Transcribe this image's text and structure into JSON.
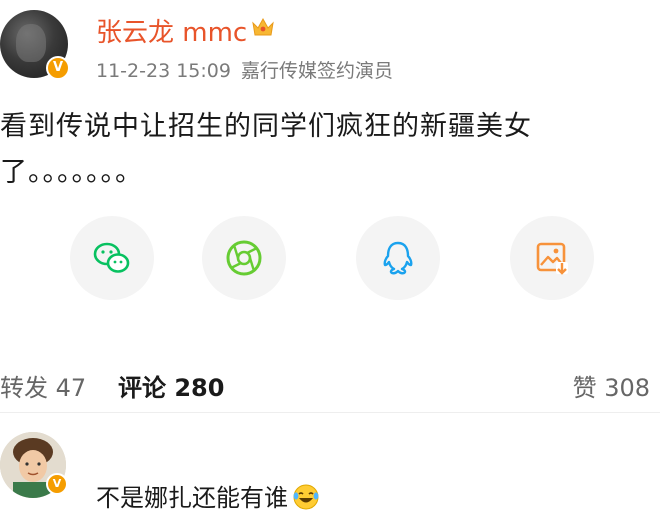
{
  "post": {
    "author": {
      "name": "张云龙 mmc",
      "verified_badge": "V",
      "crown_icon": "crown-icon"
    },
    "time": "11-2-23 15:09",
    "author_title": "嘉行传媒签约演员",
    "text_line1": "看到传说中让招生的同学们疯狂的新疆美女",
    "text_line2": "了。。。。。。。"
  },
  "share": [
    {
      "icon": "wechat-icon",
      "color": "#07c160"
    },
    {
      "icon": "moments-icon",
      "color": "#66cc33"
    },
    {
      "icon": "qq-icon",
      "color": "#1aa2ee"
    },
    {
      "icon": "save-image-icon",
      "color": "#f7923a"
    }
  ],
  "stats": {
    "reposts": "转发 47",
    "comments": "评论 280",
    "likes": "赞 308"
  },
  "comment": {
    "badge": "V",
    "text": "不是娜扎还能有谁"
  }
}
